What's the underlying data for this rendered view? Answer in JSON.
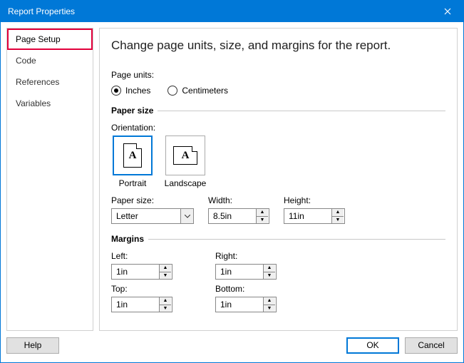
{
  "title": "Report Properties",
  "sidebar": {
    "items": [
      {
        "label": "Page Setup",
        "selected": true
      },
      {
        "label": "Code"
      },
      {
        "label": "References"
      },
      {
        "label": "Variables"
      }
    ]
  },
  "heading": "Change page units, size, and margins for the report.",
  "page_units": {
    "label": "Page units:",
    "options": [
      "Inches",
      "Centimeters"
    ],
    "selected": "Inches"
  },
  "paper_size": {
    "header": "Paper size",
    "orientation_label": "Orientation:",
    "orientations": {
      "portrait": "Portrait",
      "landscape": "Landscape",
      "selected": "Portrait"
    },
    "size_label": "Paper size:",
    "size_value": "Letter",
    "width_label": "Width:",
    "width_value": "8.5in",
    "height_label": "Height:",
    "height_value": "11in"
  },
  "margins": {
    "header": "Margins",
    "left_label": "Left:",
    "left_value": "1in",
    "right_label": "Right:",
    "right_value": "1in",
    "top_label": "Top:",
    "top_value": "1in",
    "bottom_label": "Bottom:",
    "bottom_value": "1in"
  },
  "buttons": {
    "help": "Help",
    "ok": "OK",
    "cancel": "Cancel"
  }
}
